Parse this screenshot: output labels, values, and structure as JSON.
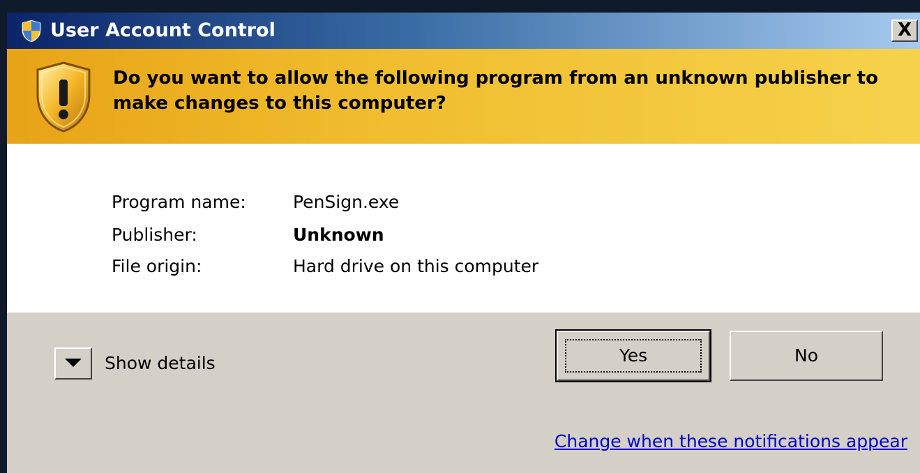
{
  "window": {
    "title": "User Account Control",
    "close_label": "X",
    "title_icon": "uac-shield-icon"
  },
  "banner": {
    "icon": "warning-shield-icon",
    "question": "Do you want to allow the following program from an unknown publisher to make changes to this computer?",
    "accent_color": "#f0bd2e"
  },
  "info": {
    "rows": [
      {
        "label": "Program name:",
        "value": "PenSign.exe"
      },
      {
        "label": "Publisher:",
        "value": "Unknown"
      },
      {
        "label": "File origin:",
        "value": "Hard drive on this computer"
      }
    ]
  },
  "actions": {
    "show_details": "Show details",
    "yes": "Yes",
    "no": "No",
    "change_link": "Change when these notifications appear"
  }
}
